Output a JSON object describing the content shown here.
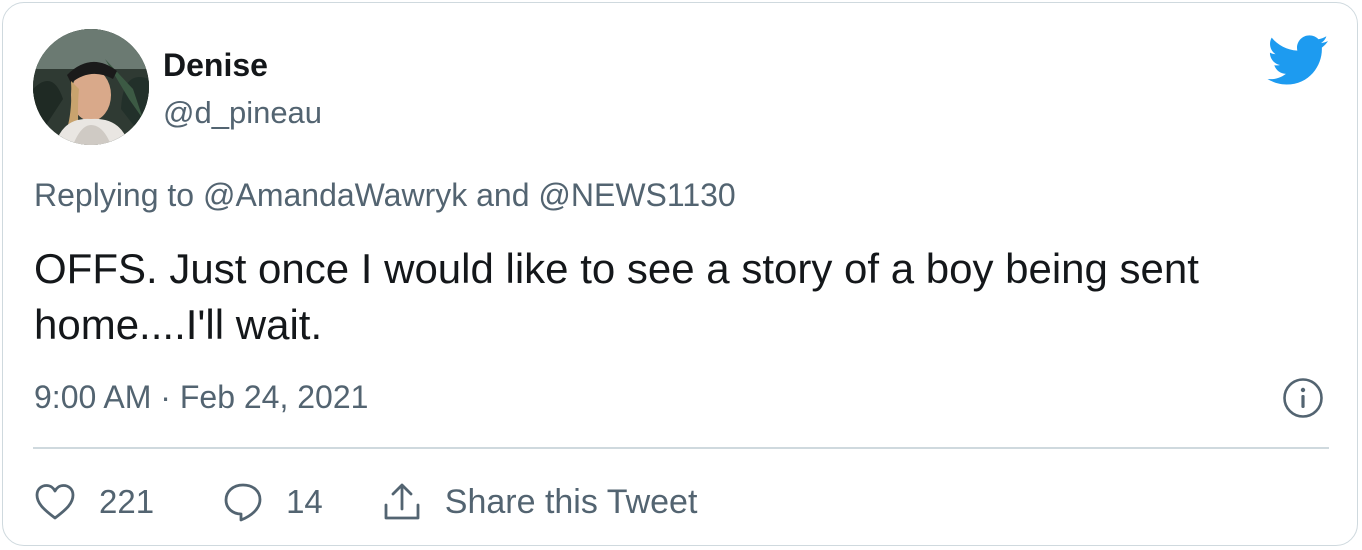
{
  "author": {
    "display_name": "Denise",
    "handle": "@d_pineau"
  },
  "reply_context": {
    "prefix": "Replying to ",
    "mention_1": "@AmandaWawryk",
    "conjunction": " and ",
    "mention_2": "@NEWS1130"
  },
  "tweet": {
    "text": "OFFS. Just once I would like to see a story of a boy being sent home....I'll wait.",
    "timestamp": "9:00 AM · Feb 24, 2021"
  },
  "actions": {
    "like_count": "221",
    "reply_count": "14",
    "share_label": "Share this Tweet"
  },
  "icons": {
    "brand": "twitter-bird-icon",
    "info": "info-icon",
    "like": "heart-icon",
    "reply": "comment-icon",
    "share": "share-icon"
  },
  "colors": {
    "brand_blue": "#1d9bf0",
    "secondary_text": "#536471",
    "primary_text": "#14171a",
    "border": "#cfd9de"
  }
}
